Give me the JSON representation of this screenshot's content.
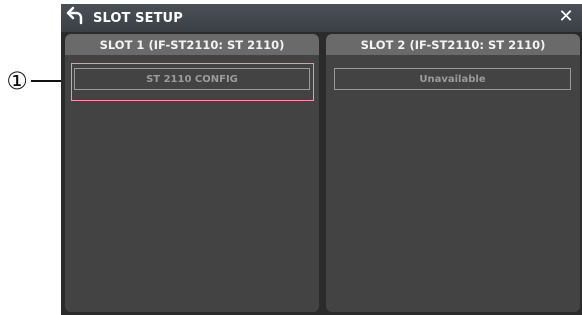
{
  "annotation": {
    "marker": "①"
  },
  "window": {
    "title": "SLOT SETUP",
    "back_icon": "back-arrow-icon",
    "close_icon": "close-icon",
    "close_glyph": "✕"
  },
  "slots": [
    {
      "header": "SLOT 1 (IF-ST2110: ST 2110)",
      "button_label": "ST 2110 CONFIG"
    },
    {
      "header": "SLOT 2 (IF-ST2110: ST 2110)",
      "status_label": "Unavailable"
    }
  ],
  "colors": {
    "window_background": "#2b2b2b",
    "panel_background": "#434343",
    "header_background": "#6a6a6a",
    "highlight": "#ff8f9a"
  }
}
